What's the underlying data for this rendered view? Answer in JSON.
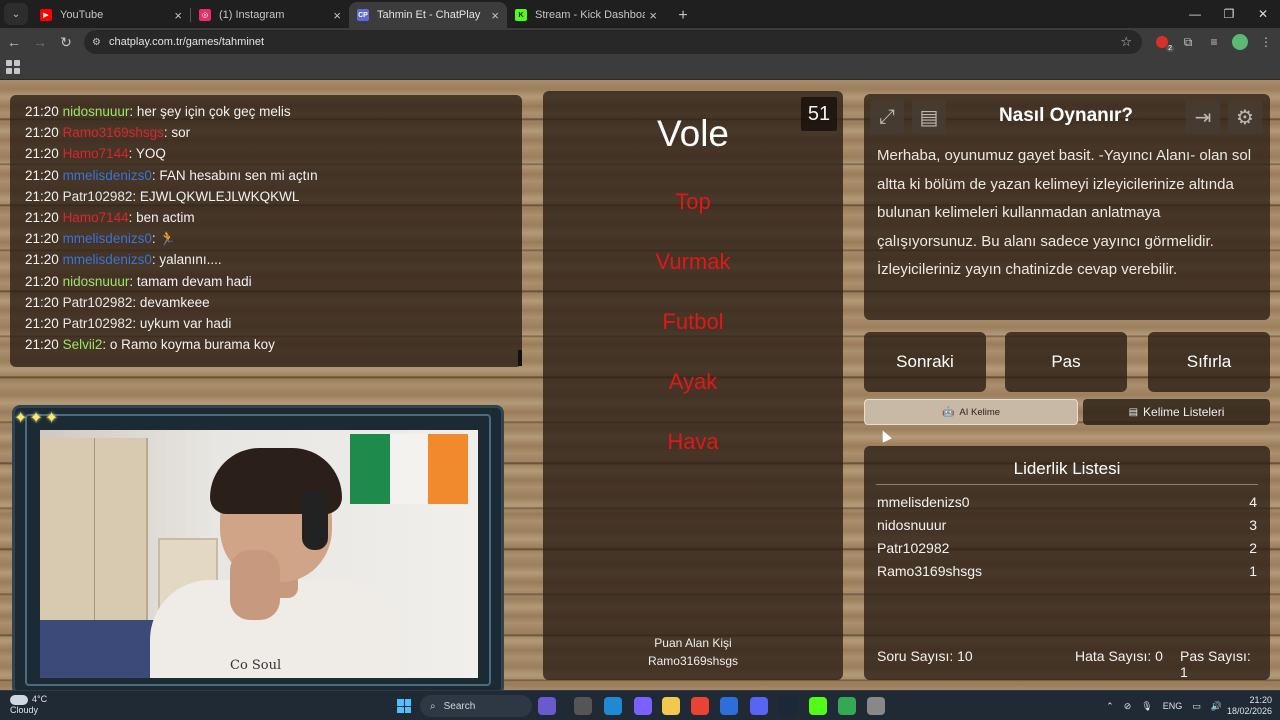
{
  "browser": {
    "tabs": [
      {
        "title": "YouTube",
        "favicon": "youtube-icon",
        "color": "#ff0000",
        "active": false
      },
      {
        "title": "(1) Instagram",
        "favicon": "instagram-icon",
        "color": "#e1306c",
        "active": false
      },
      {
        "title": "Tahmin Et - ChatPlay",
        "favicon": "chatplay-icon",
        "color": "#5f6ad8",
        "active": true
      },
      {
        "title": "Stream - Kick Dashboard",
        "favicon": "kick-icon",
        "color": "#53fc18",
        "active": false
      }
    ],
    "url": "chatplay.com.tr/games/tahminet",
    "extension_badge": "2"
  },
  "chat": {
    "messages": [
      {
        "time": "21:20",
        "user": "nidosnuuur",
        "user_color": "#9be56a",
        "text": ": her şey için çok geç melis"
      },
      {
        "time": "21:20",
        "user": "Ramo3169shsgs",
        "user_color": "#d8262f",
        "text": ": sor"
      },
      {
        "time": "21:20",
        "user": "Hamo7144",
        "user_color": "#d8262f",
        "text": ": YOQ"
      },
      {
        "time": "21:20",
        "user": "mmelisdenizs0",
        "user_color": "#3a74d9",
        "text": ": FAN hesabını sen mi açtın"
      },
      {
        "time": "21:20",
        "user": "Patr102982",
        "user_color": "#e8e8e8",
        "text": ": EJWLQKWLEJLWKQKWL"
      },
      {
        "time": "21:20",
        "user": "Hamo7144",
        "user_color": "#d8262f",
        "text": ": ben actim"
      },
      {
        "time": "21:20",
        "user": "mmelisdenizs0",
        "user_color": "#3a74d9",
        "text": ": 🏃"
      },
      {
        "time": "21:20",
        "user": "mmelisdenizs0",
        "user_color": "#3a74d9",
        "text": ": yalanını...."
      },
      {
        "time": "21:20",
        "user": "nidosnuuur",
        "user_color": "#9be56a",
        "text": ": tamam devam hadi"
      },
      {
        "time": "21:20",
        "user": "Patr102982",
        "user_color": "#e8e8e8",
        "text": ": devamkeee"
      },
      {
        "time": "21:20",
        "user": "Patr102982",
        "user_color": "#e8e8e8",
        "text": ": uykum var hadi"
      },
      {
        "time": "21:20",
        "user": "Selvii2",
        "user_color": "#9be56a",
        "text": ": o Ramo koyma burama koy"
      }
    ]
  },
  "webcam": {
    "shirt_text": "Co    Soul"
  },
  "game": {
    "counter": "51",
    "word": "Vole",
    "forbidden": [
      "Top",
      "Vurmak",
      "Futbol",
      "Ayak",
      "Hava"
    ],
    "forbidden_color": "#e01818",
    "scorer_label": "Puan Alan Kişi",
    "scorer_name": "Ramo3169shsgs"
  },
  "howto": {
    "title": "Nasıl Oynanır?",
    "text": "Merhaba, oyunumuz gayet basit. -Yayıncı Alanı- olan sol altta ki bölüm de yazan kelimeyi izleyicilerinize altında bulunan kelimeleri kullanmadan anlatmaya çalışıyorsunuz. Bu alanı sadece yayıncı görmelidir. İzleyicileriniz yayın chatinizde cevap verebilir.",
    "icons": [
      "fullscreen-icon",
      "notes-icon",
      "exit-icon",
      "settings-icon"
    ]
  },
  "controls": {
    "next": "Sonraki",
    "pass": "Pas",
    "reset": "Sıfırla",
    "ai_word": "AI Kelime",
    "word_lists": "Kelime Listeleri"
  },
  "leaderboard": {
    "title": "Liderlik Listesi",
    "rows": [
      {
        "name": "mmelisdenizs0",
        "score": "4"
      },
      {
        "name": "nidosnuuur",
        "score": "3"
      },
      {
        "name": "Patr102982",
        "score": "2"
      },
      {
        "name": "Ramo3169shsgs",
        "score": "1"
      }
    ],
    "question_count": "Soru Sayısı: 10",
    "error_count": "Hata Sayısı: 0",
    "pass_count": "Pas Sayısı: 1"
  },
  "taskbar": {
    "weather_temp": "4°C",
    "weather_label": "Cloudy",
    "search_placeholder": "Search",
    "language": "ENG",
    "time": "21:20",
    "date": "18/02/2026"
  }
}
